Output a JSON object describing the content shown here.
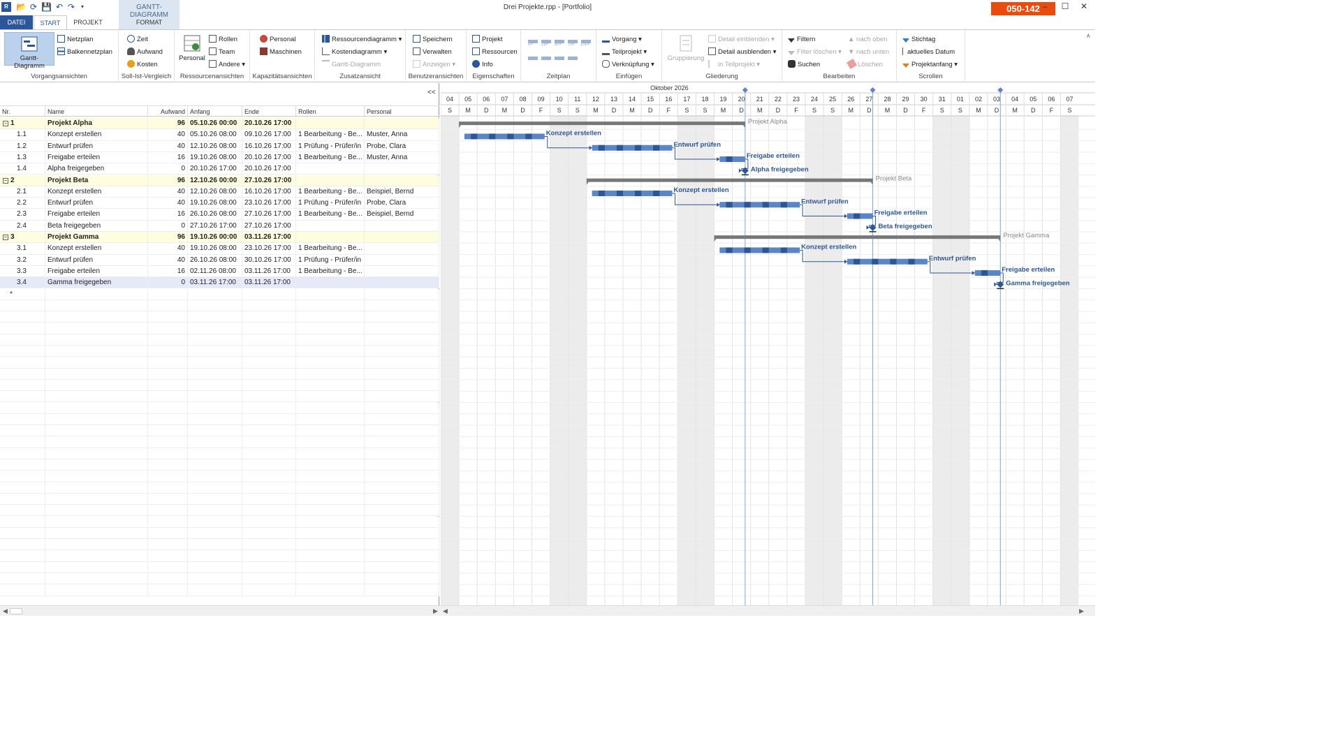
{
  "window": {
    "title": "Drei Projekte.rpp - [Portfolio]",
    "badge": "050-142",
    "minimize": "–",
    "maximize": "☐",
    "close": "✕"
  },
  "ribbon_tabs": {
    "datei": "DATEI",
    "start": "START",
    "projekt": "PROJEKT",
    "context_label": "GANTT-DIAGRAMM",
    "format": "FORMAT"
  },
  "ribbon": {
    "vorgangsansichten": {
      "label": "Vorgangsansichten",
      "gantt": "Gantt-Diagramm",
      "netzplan": "Netzplan",
      "balkennetzplan": "Balkennetzplan"
    },
    "soll_ist": {
      "label": "Soll-Ist-Vergleich",
      "zeit": "Zeit",
      "aufwand": "Aufwand",
      "kosten": "Kosten"
    },
    "ressourcenansichten": {
      "label": "Ressourcenansichten",
      "personal": "Personal",
      "rollen": "Rollen",
      "team": "Team",
      "andere": "Andere"
    },
    "kapazitaet": {
      "label": "Kapazitätsansichten",
      "personal": "Personal",
      "maschinen": "Maschinen"
    },
    "zusatz": {
      "label": "Zusatzansicht",
      "ressourcendiagramm": "Ressourcendiagramm",
      "kostendiagramm": "Kostendiagramm",
      "gantt": "Gantt-Diagramm"
    },
    "benutzer": {
      "label": "Benutzeransichten",
      "speichern": "Speichern",
      "verwalten": "Verwalten",
      "anzeigen": "Anzeigen"
    },
    "eigenschaften": {
      "label": "Eigenschaften",
      "projekt": "Projekt",
      "ressourcen": "Ressourcen",
      "info": "Info"
    },
    "zeitplan": {
      "label": "Zeitplan",
      "p0": "0×",
      "p25": "25×",
      "p50": "50×",
      "p75": "75×",
      "p100": "100×"
    },
    "einfuegen": {
      "label": "Einfügen",
      "vorgang": "Vorgang",
      "teilprojekt": "Teilprojekt",
      "verknuepfung": "Verknüpfung"
    },
    "gliederung": {
      "label": "Gliederung",
      "gruppierung": "Gruppierung",
      "detail_ein": "Detail einblenden",
      "detail_aus": "Detail ausblenden",
      "in_teilprojekt": "in Teilprojekt"
    },
    "bearbeiten": {
      "label": "Bearbeiten",
      "filtern": "Filtern",
      "filter_loeschen": "Filter löschen",
      "suchen": "Suchen",
      "nach_oben": "nach oben",
      "nach_unten": "nach unten",
      "loeschen": "Löschen"
    },
    "scrollen": {
      "label": "Scrollen",
      "stichtag": "Stichtag",
      "aktuelles_datum": "aktuelles Datum",
      "projektanfang": "Projektanfang"
    }
  },
  "table": {
    "collapse": "<<",
    "headers": {
      "nr": "Nr.",
      "name": "Name",
      "aufwand": "Aufwand",
      "anfang": "Anfang",
      "ende": "Ende",
      "rollen": "Rollen",
      "personal": "Personal"
    },
    "rows": [
      {
        "nr": "1",
        "name": "Projekt Alpha",
        "aufwand": "96",
        "anfang": "05.10.26 00:00",
        "ende": "20.10.26 17:00",
        "rollen": "",
        "personal": "",
        "type": "project"
      },
      {
        "nr": "1.1",
        "name": "Konzept erstellen",
        "aufwand": "40",
        "anfang": "05.10.26 08:00",
        "ende": "09.10.26 17:00",
        "rollen": "1 Bearbeitung - Be...",
        "personal": "Muster, Anna",
        "type": "task"
      },
      {
        "nr": "1.2",
        "name": "Entwurf prüfen",
        "aufwand": "40",
        "anfang": "12.10.26 08:00",
        "ende": "16.10.26 17:00",
        "rollen": "1 Prüfung - Prüfer/in",
        "personal": "Probe, Clara",
        "type": "task"
      },
      {
        "nr": "1.3",
        "name": "Freigabe erteilen",
        "aufwand": "16",
        "anfang": "19.10.26 08:00",
        "ende": "20.10.26 17:00",
        "rollen": "1 Bearbeitung - Be...",
        "personal": "Muster, Anna",
        "type": "task"
      },
      {
        "nr": "1.4",
        "name": "Alpha freigegeben",
        "aufwand": "0",
        "anfang": "20.10.26 17:00",
        "ende": "20.10.26 17:00",
        "rollen": "",
        "personal": "",
        "type": "milestone"
      },
      {
        "nr": "2",
        "name": "Projekt Beta",
        "aufwand": "96",
        "anfang": "12.10.26 00:00",
        "ende": "27.10.26 17:00",
        "rollen": "",
        "personal": "",
        "type": "project"
      },
      {
        "nr": "2.1",
        "name": "Konzept erstellen",
        "aufwand": "40",
        "anfang": "12.10.26 08:00",
        "ende": "16.10.26 17:00",
        "rollen": "1 Bearbeitung - Be...",
        "personal": "Beispiel, Bernd",
        "type": "task"
      },
      {
        "nr": "2.2",
        "name": "Entwurf prüfen",
        "aufwand": "40",
        "anfang": "19.10.26 08:00",
        "ende": "23.10.26 17:00",
        "rollen": "1 Prüfung - Prüfer/in",
        "personal": "Probe, Clara",
        "type": "task"
      },
      {
        "nr": "2.3",
        "name": "Freigabe erteilen",
        "aufwand": "16",
        "anfang": "26.10.26 08:00",
        "ende": "27.10.26 17:00",
        "rollen": "1 Bearbeitung - Be...",
        "personal": "Beispiel, Bernd",
        "type": "task"
      },
      {
        "nr": "2.4",
        "name": "Beta freigegeben",
        "aufwand": "0",
        "anfang": "27.10.26 17:00",
        "ende": "27.10.26 17:00",
        "rollen": "",
        "personal": "",
        "type": "milestone"
      },
      {
        "nr": "3",
        "name": "Projekt Gamma",
        "aufwand": "96",
        "anfang": "19.10.26 00:00",
        "ende": "03.11.26 17:00",
        "rollen": "",
        "personal": "",
        "type": "project"
      },
      {
        "nr": "3.1",
        "name": "Konzept erstellen",
        "aufwand": "40",
        "anfang": "19.10.26 08:00",
        "ende": "23.10.26 17:00",
        "rollen": "1 Bearbeitung - Be...",
        "personal": "",
        "type": "task"
      },
      {
        "nr": "3.2",
        "name": "Entwurf prüfen",
        "aufwand": "40",
        "anfang": "26.10.26 08:00",
        "ende": "30.10.26 17:00",
        "rollen": "1 Prüfung - Prüfer/in",
        "personal": "",
        "type": "task"
      },
      {
        "nr": "3.3",
        "name": "Freigabe erteilen",
        "aufwand": "16",
        "anfang": "02.11.26 08:00",
        "ende": "03.11.26 17:00",
        "rollen": "1 Bearbeitung - Be...",
        "personal": "",
        "type": "task"
      },
      {
        "nr": "3.4",
        "name": "Gamma freigegeben",
        "aufwand": "0",
        "anfang": "03.11.26 17:00",
        "ende": "03.11.26 17:00",
        "rollen": "",
        "personal": "",
        "type": "milestone"
      }
    ],
    "new_row": "*"
  },
  "gantt": {
    "month_label": "Oktober 2026",
    "days": [
      "04",
      "05",
      "06",
      "07",
      "08",
      "09",
      "10",
      "11",
      "12",
      "13",
      "14",
      "15",
      "16",
      "17",
      "18",
      "19",
      "20",
      "21",
      "22",
      "23",
      "24",
      "25",
      "26",
      "27",
      "28",
      "29",
      "30",
      "31",
      "01",
      "02",
      "03",
      "04",
      "05",
      "06",
      "07"
    ],
    "weekdays": [
      "S",
      "M",
      "D",
      "M",
      "D",
      "F",
      "S",
      "S",
      "M",
      "D",
      "M",
      "D",
      "F",
      "S",
      "S",
      "M",
      "D",
      "M",
      "D",
      "F",
      "S",
      "S",
      "M",
      "D",
      "M",
      "D",
      "F",
      "S",
      "S",
      "M",
      "D",
      "M",
      "D",
      "F",
      "S"
    ],
    "weekend_day_indices": [
      0,
      6,
      7,
      13,
      14,
      20,
      21,
      27,
      28,
      34
    ],
    "bars": [
      {
        "label": "Projekt Alpha",
        "type": "summary",
        "start": 1,
        "end": 16.7
      },
      {
        "label": "Konzept erstellen",
        "type": "task",
        "start": 1.3,
        "end": 5.7,
        "pred": null
      },
      {
        "label": "Entwurf prüfen",
        "type": "task",
        "start": 8.3,
        "end": 12.7,
        "pred": 1
      },
      {
        "label": "Freigabe erteilen",
        "type": "task",
        "start": 15.3,
        "end": 16.7,
        "pred": 2
      },
      {
        "label": "Alpha freigegeben",
        "type": "milestone",
        "start": 16.7,
        "end": 16.7,
        "pred": 3
      },
      {
        "label": "Projekt Beta",
        "type": "summary",
        "start": 8,
        "end": 23.7
      },
      {
        "label": "Konzept erstellen",
        "type": "task",
        "start": 8.3,
        "end": 12.7,
        "pred": null
      },
      {
        "label": "Entwurf prüfen",
        "type": "task",
        "start": 15.3,
        "end": 19.7,
        "pred": 6
      },
      {
        "label": "Freigabe erteilen",
        "type": "task",
        "start": 22.3,
        "end": 23.7,
        "pred": 7
      },
      {
        "label": "Beta freigegeben",
        "type": "milestone",
        "start": 23.7,
        "end": 23.7,
        "pred": 8
      },
      {
        "label": "Projekt Gamma",
        "type": "summary",
        "start": 15,
        "end": 30.7
      },
      {
        "label": "Konzept erstellen",
        "type": "task",
        "start": 15.3,
        "end": 19.7,
        "pred": null
      },
      {
        "label": "Entwurf prüfen",
        "type": "task",
        "start": 22.3,
        "end": 26.7,
        "pred": 11
      },
      {
        "label": "Freigabe erteilen",
        "type": "task",
        "start": 29.3,
        "end": 30.7,
        "pred": 12
      },
      {
        "label": "Gamma freigegeben",
        "type": "milestone",
        "start": 30.7,
        "end": 30.7,
        "pred": 13
      }
    ],
    "deadline_markers": [
      16.7,
      23.7,
      30.7
    ],
    "colors": {
      "bar": "#2e5596",
      "bar_light": "#5b86c6",
      "summary": "#777777",
      "label": "#2e5596",
      "summary_label": "#888888",
      "weekend": "#ececec"
    }
  }
}
